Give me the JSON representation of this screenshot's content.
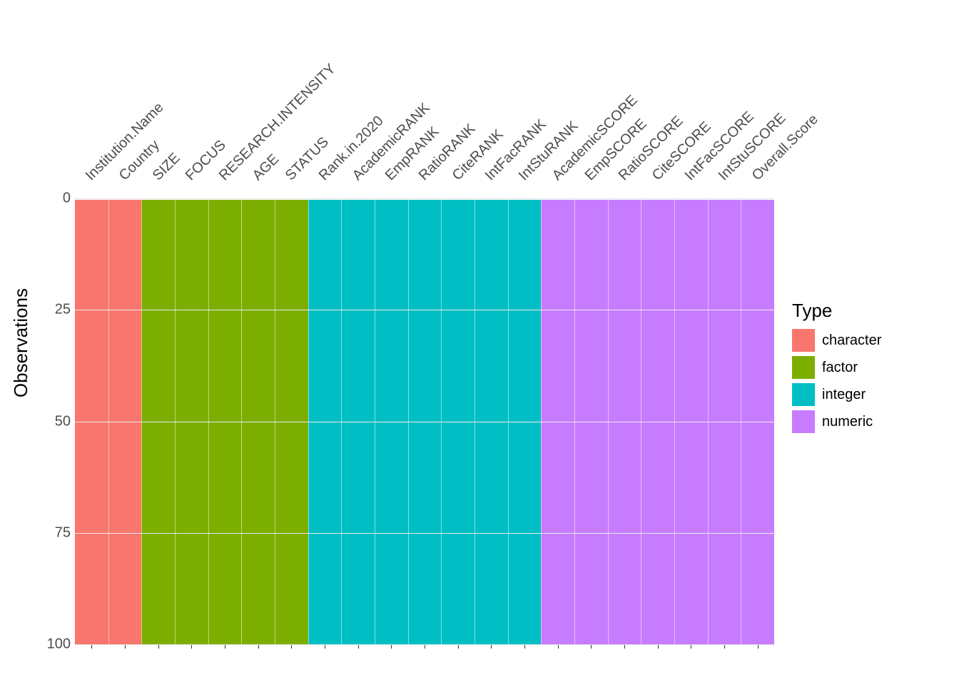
{
  "chart_data": {
    "type": "bar",
    "title": "",
    "ylabel": "Observations",
    "xlabel": "",
    "ylim": [
      0,
      100
    ],
    "y_reversed": true,
    "y_ticks": [
      0,
      25,
      50,
      75,
      100
    ],
    "legend_title": "Type",
    "legend": [
      {
        "label": "character",
        "color": "#F8766D"
      },
      {
        "label": "factor",
        "color": "#7CAE00"
      },
      {
        "label": "integer",
        "color": "#00BFC4"
      },
      {
        "label": "numeric",
        "color": "#C77CFF"
      }
    ],
    "columns": [
      {
        "name": "Institution.Name",
        "type": "character",
        "value": 100
      },
      {
        "name": "Country",
        "type": "character",
        "value": 100
      },
      {
        "name": "SIZE",
        "type": "factor",
        "value": 100
      },
      {
        "name": "FOCUS",
        "type": "factor",
        "value": 100
      },
      {
        "name": "RESEARCH.INTENSITY",
        "type": "factor",
        "value": 100
      },
      {
        "name": "AGE",
        "type": "factor",
        "value": 100
      },
      {
        "name": "STATUS",
        "type": "factor",
        "value": 100
      },
      {
        "name": "Rank.in.2020",
        "type": "integer",
        "value": 100
      },
      {
        "name": "AcademicRANK",
        "type": "integer",
        "value": 100
      },
      {
        "name": "EmpRANK",
        "type": "integer",
        "value": 100
      },
      {
        "name": "RatioRANK",
        "type": "integer",
        "value": 100
      },
      {
        "name": "CiteRANK",
        "type": "integer",
        "value": 100
      },
      {
        "name": "IntFacRANK",
        "type": "integer",
        "value": 100
      },
      {
        "name": "IntStuRANK",
        "type": "integer",
        "value": 100
      },
      {
        "name": "AcademicSCORE",
        "type": "numeric",
        "value": 100
      },
      {
        "name": "EmpSCORE",
        "type": "numeric",
        "value": 100
      },
      {
        "name": "RatioSCORE",
        "type": "numeric",
        "value": 100
      },
      {
        "name": "CiteSCORE",
        "type": "numeric",
        "value": 100
      },
      {
        "name": "IntFacSCORE",
        "type": "numeric",
        "value": 100
      },
      {
        "name": "IntStuSCORE",
        "type": "numeric",
        "value": 100
      },
      {
        "name": "Overall.Score",
        "type": "numeric",
        "value": 100
      }
    ]
  }
}
